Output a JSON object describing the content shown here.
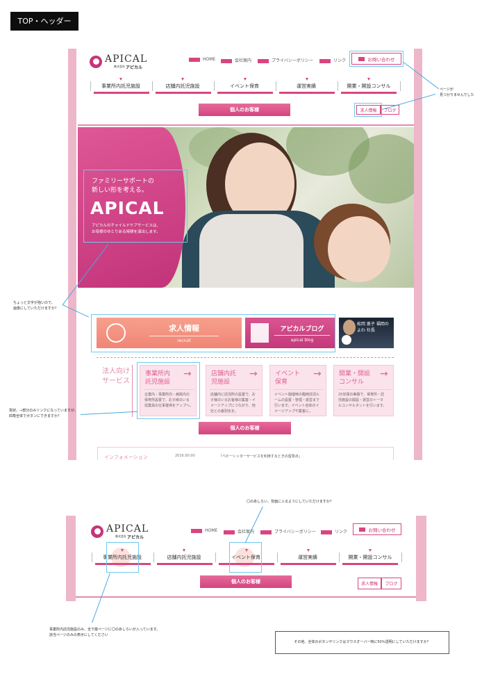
{
  "page_tag": "TOP・ヘッダー",
  "logo": {
    "name": "APICAL",
    "sub_small": "株式会社",
    "sub_brand": "アピカル"
  },
  "util_links": [
    "HOME",
    "会社案内",
    "プライバシーポリシー",
    "リンク"
  ],
  "contact_label": "お問い合わせ",
  "nav": [
    "事業所内託児施設",
    "店舗内託児施設",
    "イベント保育",
    "運営実績",
    "開業・開設コンサル"
  ],
  "kojin_label": "個人のお客様",
  "small_btns": {
    "recruit": "求人情報",
    "blog": "ブログ"
  },
  "hero": {
    "line1": "ファミリーサポートの",
    "line2": "新しい形を考える。",
    "title": "APICAL",
    "desc1": "アピカルのチャイルドケアサービスは、",
    "desc2": "お母様のゆとりある時間を演出します。"
  },
  "cta": {
    "recruit_title": "求人情報",
    "recruit_sub": "recruit",
    "blog_title": "アピカルブログ",
    "blog_sub": "apical blog",
    "banner_text": "松岡 恵子 福岡のよわ 社長"
  },
  "services": {
    "label1": "法人向け",
    "label2": "サービス",
    "cards": [
      {
        "t1": "事業所内",
        "t2": "託児施設",
        "d1": "企業内・事業所内・病院内の",
        "d2": "保育所設置で、お子様のいる",
        "d3": "従業員の仕事復帰をアップへ。"
      },
      {
        "t1": "店舗内託",
        "t2": "児施設",
        "d1": "店舗内に託児所の設置で、お",
        "d2": "子様のいるお客様の集客・イ",
        "d3": "メージアップにつながり、他",
        "d4": "社との差別化を。"
      },
      {
        "t1": "イベント",
        "t2": "保育",
        "d1": "イベント開催時の臨時託児ル",
        "d2": "ームの設置・管理・運営まで",
        "d3": "行います。イベント自体のイ",
        "d4": "メージアップや集客に。"
      },
      {
        "t1": "開業・開設",
        "t2": "コンサル",
        "d1": "25年間の実績で、保育所・託",
        "d2": "児施設の開設・運営のトータ",
        "d3": "ルコンサルタントを行います。"
      }
    ]
  },
  "info": {
    "label": "インフォメーション",
    "date": "2016.00.00",
    "text": "「ベビーシッターサービスを利用するときの留意点」"
  },
  "notes": {
    "n1a": "ページが",
    "n1b": "見つかりませんでした",
    "n2a": "ちょっと文字が強いので、",
    "n2b": "画像にしていただけますか？",
    "n3a": "現状、→部分のみリンクになっていますが、",
    "n3b": "四角全体でボタンにできますか？",
    "n4": "〇のあしらい、背面に入るようにしていただけますか？",
    "n5a": "事業所内託児施設のみ、全下層ページに〇のあしらいが入っています。",
    "n5b": "該当ページのみの表示にしてください",
    "n6": "その他、全体のボタンやリンクはマウスオーバー時に50％透明にしていただけますか？"
  },
  "colors": {
    "accent": "#d9457f",
    "frame": "#edb7c9",
    "card": "#fbe3ec",
    "annotation": "#6ec8ee"
  }
}
